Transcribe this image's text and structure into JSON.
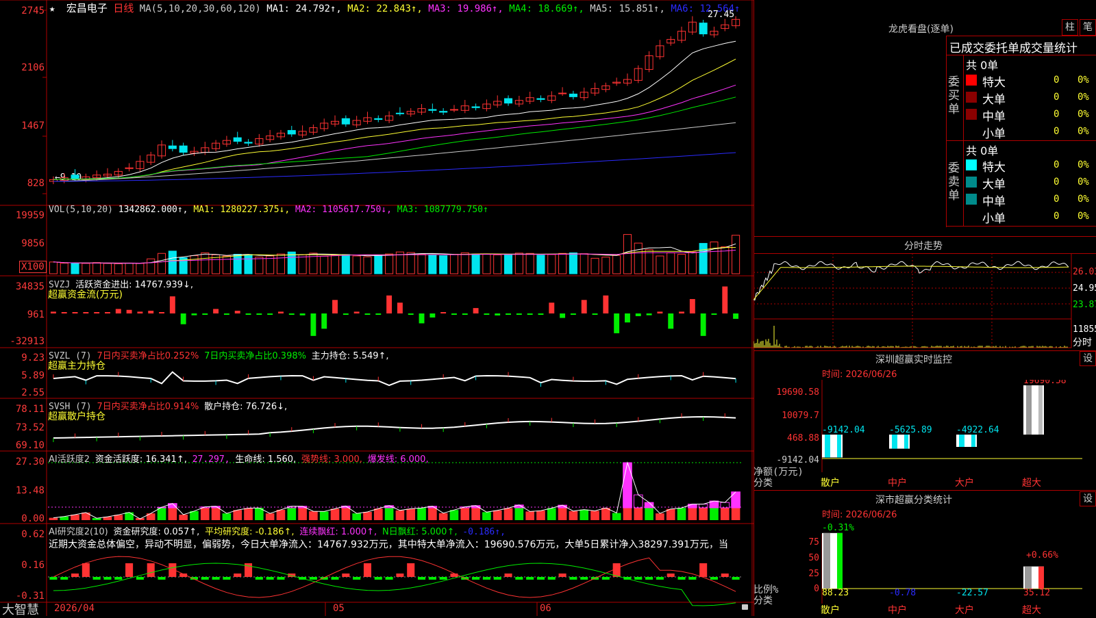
{
  "colors": {
    "up": "#ff3333",
    "down": "#00e5ee",
    "green": "#00ee00",
    "magenta": "#ff33ff",
    "yellow": "#ffff33",
    "white": "#ffffff",
    "blue": "#2b2bff"
  },
  "main_chart": {
    "star": "★",
    "stock_name": "宏昌电子",
    "period": "日线",
    "ma_params": "MA(5,10,20,30,60,120)",
    "ma1": "MA1: 24.792↑,",
    "ma2": "MA2: 22.843↑,",
    "ma3": "MA3: 19.986↑,",
    "ma4": "MA4: 18.669↑,",
    "ma5": "MA5: 15.851↑,",
    "ma6": "MA6: 12.564↑",
    "y_labels": [
      "2745",
      "2106",
      "1467",
      "828"
    ],
    "high_label": "27.45",
    "low_label": "9.10"
  },
  "vol_panel": {
    "title": "VOL(5,10,20)",
    "value": "1342862.000↑,",
    "ma1": "MA1: 1280227.375↓,",
    "ma2": "MA2: 1105617.750↓,",
    "ma3": "MA3: 1087779.750↑",
    "y_labels": [
      "19959",
      "9856"
    ],
    "unit": "X100"
  },
  "svzj_panel": {
    "name": "SVZJ",
    "label": "活跃资金进出: 14767.939↓,",
    "subtitle": "超赢资金流(万元)",
    "y_labels": [
      "34835",
      "961",
      "-32913"
    ]
  },
  "svzl_panel": {
    "name": "SVZL (7)",
    "a": "7日内买卖净占比0.252%",
    "b": "7日内买卖净占比0.398%",
    "c": "主力持仓: 5.549↑,",
    "subtitle": "超赢主力持仓",
    "y_labels": [
      "9.23",
      "5.89",
      "2.55"
    ]
  },
  "svsh_panel": {
    "name": "SVSH (7)",
    "a": "7日内买卖净占比0.914%",
    "c": "散户持仓: 76.726↓,",
    "subtitle": "超赢散户持仓",
    "y_labels": [
      "78.11",
      "73.52",
      "69.10"
    ]
  },
  "ai_active": {
    "name": "AI活跃度2",
    "a": "资金活跃度: 16.341↑,",
    "b": "27.297,",
    "c": "生命线: 1.560,",
    "d": "强势线: 3.000,",
    "e": "爆发线: 6.000,",
    "y_labels": [
      "27.30",
      "13.48",
      "0.00"
    ]
  },
  "ai_research": {
    "name": "AI研究度2(10)",
    "a": "资金研究度: 0.057↑,",
    "b": "平均研究度: -0.186↑,",
    "c": "连续飘红: 1.000↑,",
    "d": "N日飘红: 5.000↑,",
    "e": "-0.186↑,",
    "comment": "近期大资金总体偏空，异动不明显，偏弱势，今日大单净流入：14767.932万元，其中特大单净流入：19690.576万元，大单5日累计净入38297.391万元，当",
    "y_labels": [
      "0.62",
      "0.16",
      "-0.31"
    ]
  },
  "bottom": {
    "brand": "大智慧",
    "date_start": "2026/04",
    "m05": "05",
    "m06": "06"
  },
  "lhb": {
    "title": "龙虎看盘(逐单)",
    "btn1": "柱",
    "btn2": "笔",
    "heading": "已成交委托单成交量统计",
    "buy": {
      "side": "委买单",
      "total": "共 0单",
      "rows": [
        {
          "name": "特大",
          "v": "0",
          "p": "0%"
        },
        {
          "name": "大单",
          "v": "0",
          "p": "0%"
        },
        {
          "name": "中单",
          "v": "0",
          "p": "0%"
        },
        {
          "name": "小单",
          "v": "0",
          "p": "0%"
        }
      ]
    },
    "sell": {
      "side": "委卖单",
      "total": "共 0单",
      "rows": [
        {
          "name": "特大",
          "v": "0",
          "p": "0%"
        },
        {
          "name": "大单",
          "v": "0",
          "p": "0%"
        },
        {
          "name": "中单",
          "v": "0",
          "p": "0%"
        },
        {
          "name": "小单",
          "v": "0",
          "p": "0%"
        }
      ]
    }
  },
  "intraday": {
    "title": "分时走势",
    "p1": "26.03",
    "p2": "24.95",
    "p3": "23.87",
    "vol": "11855",
    "unit": "分时"
  },
  "sz_monitor": {
    "title": "深圳超赢实时监控",
    "btn": "设",
    "time": "时间: 2026/06/26",
    "y_labels": [
      "19690.58",
      "10079.7",
      "468.88",
      "-9142.04"
    ],
    "values": [
      "-9142.04",
      "-5625.89",
      "-4922.64",
      "19690.58"
    ],
    "cats": [
      "散户",
      "中户",
      "大户",
      "超大"
    ],
    "ylabel": "净额(万元)",
    "xlabel": "分类"
  },
  "sz_class": {
    "title": "深市超赢分类统计",
    "btn": "设",
    "time": "时间: 2026/06/26",
    "y_labels": [
      "75",
      "50",
      "25",
      "0"
    ],
    "top_labels": [
      "-0.31%",
      "+0.66%"
    ],
    "values": [
      "88.23",
      "-0.78",
      "-22.57",
      "35.12"
    ],
    "cats": [
      "散户",
      "中户",
      "大户",
      "超大"
    ],
    "ylabel": "比例%",
    "xlabel": "分类"
  },
  "chart_data": [
    {
      "type": "candlestick",
      "title": "宏昌电子 日线",
      "ylim": [
        8.28,
        27.45
      ],
      "series_names": [
        "MA1",
        "MA2",
        "MA3",
        "MA4",
        "MA5",
        "MA6"
      ],
      "close": [
        9.6,
        9.8,
        9.7,
        9.9,
        10.1,
        10.2,
        10.5,
        10.9,
        11.6,
        12.3,
        13.4,
        13.0,
        12.6,
        12.7,
        13.1,
        13.6,
        13.9,
        13.8,
        13.6,
        14.1,
        14.4,
        14.7,
        14.6,
        14.9,
        15.3,
        15.8,
        16.0,
        15.7,
        16.1,
        16.4,
        16.2,
        16.6,
        16.9,
        17.1,
        17.4,
        17.2,
        17.0,
        17.3,
        17.7,
        17.5,
        17.9,
        18.2,
        18.0,
        18.3,
        18.6,
        18.4,
        18.8,
        19.1,
        18.7,
        19.2,
        19.6,
        19.9,
        20.3,
        20.6,
        21.8,
        23.2,
        24.3,
        25.0,
        25.9,
        26.9,
        25.6,
        25.9,
        26.6,
        27.2
      ],
      "ma1_last": 24.792,
      "ma2_last": 22.843,
      "ma3_last": 19.986,
      "ma4_last": 18.669,
      "ma5_last": 15.851,
      "ma6_last": 12.564
    },
    {
      "type": "bar",
      "title": "VOL(5,10,20)",
      "ylim": [
        0,
        19959
      ],
      "values": [
        4100,
        3700,
        3600,
        3600,
        3900,
        3600,
        3500,
        3700,
        3600,
        5200,
        7100,
        7900,
        5600,
        6300,
        7300,
        6600,
        6200,
        6800,
        6700,
        5800,
        6200,
        6900,
        7600,
        6600,
        7200,
        6100,
        6400,
        6700,
        6200,
        5900,
        6500,
        6900,
        7600,
        7400,
        6800,
        6600,
        6300,
        6800,
        7300,
        6900,
        6800,
        6600,
        6700,
        7200,
        7100,
        6500,
        6700,
        7100,
        7300,
        7000,
        5400,
        5800,
        6400,
        13700,
        10700,
        8400,
        6200,
        7300,
        6800,
        7600,
        10600,
        11100,
        9400,
        13428
      ]
    },
    {
      "type": "bar",
      "title": "SVZJ",
      "ylim": [
        -32913,
        34835
      ],
      "values": [
        2000,
        800,
        600,
        900,
        700,
        900,
        5000,
        4000,
        2000,
        3000,
        1000,
        19000,
        -12000,
        -2000,
        -1200,
        5000,
        -1500,
        3000,
        -1000,
        -500,
        -800,
        2000,
        -600,
        -2100,
        -25000,
        -17000,
        15000,
        -1000,
        2000,
        -1200,
        -900,
        20000,
        12000,
        -1000,
        -11000,
        -4500,
        1500,
        -900,
        -800,
        6000,
        -1000,
        -2200,
        -700,
        -1200,
        -800,
        -500,
        12000,
        -5000,
        -900,
        15000,
        -800,
        20000,
        -22000,
        -10000,
        -3000,
        -2000,
        2000,
        -17000,
        2000,
        16000,
        -25000,
        -900,
        30000,
        -6000,
        -11000,
        12000,
        14767
      ]
    }
  ]
}
